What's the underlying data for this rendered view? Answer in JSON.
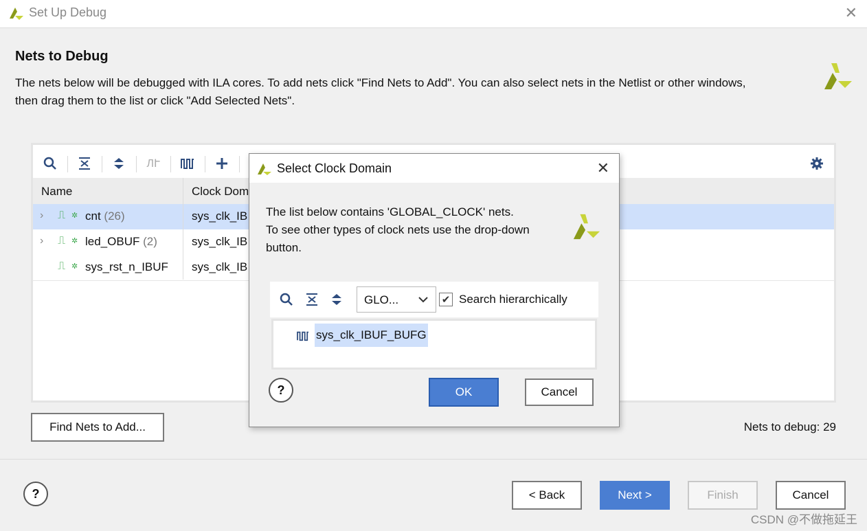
{
  "window": {
    "title": "Set Up Debug"
  },
  "header": {
    "title": "Nets to Debug",
    "description_line1": "The nets below will be debugged with ILA cores. To add nets click \"Find Nets to Add\". You can also select nets in the Netlist or other windows,",
    "description_line2": "then drag them to the list or click \"Add Selected Nets\"."
  },
  "table": {
    "columns": [
      "Name",
      "Clock Dom"
    ],
    "rows": [
      {
        "name": "cnt",
        "count": "(26)",
        "clock": "sys_clk_IB",
        "expandable": true,
        "selected": true
      },
      {
        "name": "led_OBUF",
        "count": "(2)",
        "clock": "sys_clk_IB",
        "expandable": true,
        "selected": false
      },
      {
        "name": "sys_rst_n_IBUF",
        "count": "",
        "clock": "sys_clk_IB",
        "expandable": false,
        "selected": false
      }
    ]
  },
  "buttons": {
    "find_nets": "Find Nets to Add...",
    "back": "< Back",
    "next": "Next >",
    "finish": "Finish",
    "cancel": "Cancel",
    "help": "?"
  },
  "status": {
    "nets_to_debug": "Nets to debug: 29"
  },
  "dialog": {
    "title": "Select Clock Domain",
    "description_line1": "The list below contains 'GLOBAL_CLOCK' nets.",
    "description_line2": "To see other types of clock nets use the drop-down",
    "description_line3": "button.",
    "dropdown_value": "GLO...",
    "search_label": "Search hierarchically",
    "search_checked": true,
    "list_items": [
      "sys_clk_IBUF_BUFG"
    ],
    "ok": "OK",
    "cancel": "Cancel",
    "help": "?"
  },
  "watermark": "CSDN @不做拖延王",
  "colors": {
    "accent": "#4a7ed2",
    "selection": "#cfe0fb",
    "net_icon": "#3aa64a",
    "logo_dark": "#8a9a1a",
    "logo_light": "#c8d43a"
  }
}
